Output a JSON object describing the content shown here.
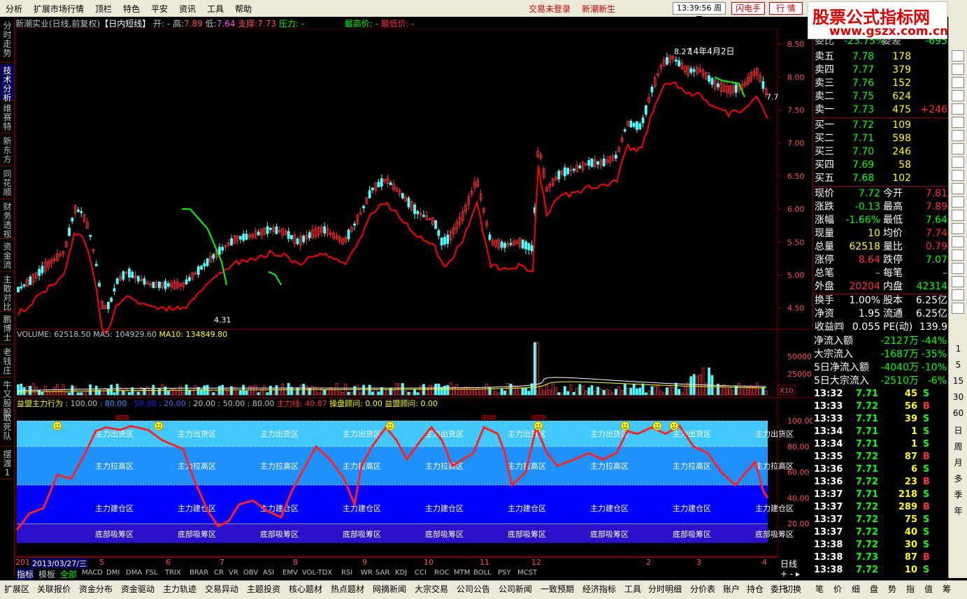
{
  "menu": [
    "分析",
    "扩展市场行情",
    "顶栏",
    "特色",
    "平安",
    "资讯",
    "工具",
    "帮助"
  ],
  "menu_warn": [
    "交易未登录",
    "新潮新生"
  ],
  "clock": "13:39:56 周三",
  "flash": "闪电手",
  "hq": "行 情",
  "brand": {
    "line1": "股票公式指标网",
    "line2": "www.gszx.com.cn"
  },
  "left_tabs": [
    "分时走势",
    "技术分析",
    "维赛特",
    "新东方",
    "同花顺",
    "财务透视",
    "资金流",
    "主散对比",
    "鹏博士",
    "老钱庄",
    "牛又股股",
    "敢死队",
    "摆渡1"
  ],
  "title": {
    "name": "新潮实业(日线,前复权)",
    "formula": "【日内短线】",
    "open": "开: -",
    "high_l": "高:",
    "high_v": "7.89",
    "low_l": "低:",
    "low_v": "7.64",
    "support_l": "支撑:",
    "support_v": "7.73",
    "pressure_l": "压力: -",
    "maxp": "最高价: -",
    "minp": "最低价: -"
  },
  "annot": {
    "hi": "8.27",
    "date": "14年4月2日",
    "lo": "4.31",
    "lastv": "7.7"
  },
  "price_axis": [
    "8.50",
    "8.00",
    "7.50",
    "7.00",
    "6.50",
    "6.00",
    "5.50",
    "5.00",
    "4.50"
  ],
  "volume_label": {
    "vol": "VOLUME: 62518.50",
    "ma5": "MA5: 104929.60",
    "ma10": "MA10: 134849.80"
  },
  "vol_axis": [
    "50000",
    "25000"
  ],
  "vol_unit": "X10",
  "ind_label": {
    "name": "益盟主力行为",
    "p1": ": 100.00",
    "p2": ": 80.00",
    "p3": ": 50.00",
    "p4": ": 20.00",
    "p5": ": 20.00",
    "p6": ": 50.00",
    "p7": ": 80.00",
    "zl": "主力线: 40.87",
    "ph": "操盘顾问: 0.00",
    "ym": "益盟顾问: 0.00"
  },
  "ind_axis": [
    "100.00",
    "80.00",
    "60.00",
    "40.00",
    "20.00"
  ],
  "zones": [
    "主力出货区",
    "主力拉高区",
    "主力建仓区",
    "底部吸筹区"
  ],
  "date": {
    "prefix": "201",
    "cur": "2013/03/27/三",
    "months": [
      "5",
      "6",
      "7",
      "8",
      "9",
      "10",
      "11",
      "12",
      "2",
      "3",
      "4"
    ],
    "period": "日线"
  },
  "ind_tabs": [
    "指标",
    "模板",
    "全部",
    "MACD",
    "DMI",
    "DMA",
    "FSL",
    "TRIX",
    "BRAR",
    "CR",
    "VR",
    "OBV",
    "ASI",
    "EMV",
    "VOL-TDX",
    "RSI",
    "WR",
    "SAR",
    "KDJ",
    "CCI",
    "ROC",
    "MTM",
    "BOLL",
    "PSY",
    "MCST"
  ],
  "quote": {
    "wb": [
      "委比",
      "-23.75%",
      "委差",
      "-695"
    ],
    "sell": [
      [
        "卖五",
        "7.78",
        "178",
        ""
      ],
      [
        "卖四",
        "7.77",
        "379",
        ""
      ],
      [
        "卖三",
        "7.76",
        "152",
        ""
      ],
      [
        "卖二",
        "7.75",
        "624",
        ""
      ],
      [
        "卖一",
        "7.73",
        "475",
        "+246"
      ]
    ],
    "buy": [
      [
        "买一",
        "7.72",
        "109"
      ],
      [
        "买二",
        "7.71",
        "598"
      ],
      [
        "买三",
        "7.70",
        "246"
      ],
      [
        "买四",
        "7.69",
        "58"
      ],
      [
        "买五",
        "7.68",
        "102"
      ]
    ],
    "stats": [
      [
        "现价",
        "7.72",
        "今开",
        "7.81"
      ],
      [
        "涨跌",
        "-0.13",
        "最高",
        "7.89"
      ],
      [
        "涨幅",
        "-1.66%",
        "最低",
        "7.64"
      ],
      [
        "现量",
        "10",
        "均价",
        "7.74"
      ],
      [
        "总量",
        "62518",
        "量比",
        "0.79"
      ],
      [
        "涨停",
        "8.64",
        "跌停",
        "7.07"
      ],
      [
        "总笔",
        "–",
        "每笔",
        "–"
      ],
      [
        "外盘",
        "20204",
        "内盘",
        "42314"
      ]
    ],
    "fund": [
      [
        "换手",
        "1.00%",
        "股本",
        "6.25亿"
      ],
      [
        "净资",
        "1.95",
        "流通",
        "6.25亿"
      ],
      [
        "收益㈣",
        "0.055",
        "PE(动)",
        "139.9"
      ]
    ]
  },
  "flow": [
    [
      "净流入额",
      "-2127万",
      "-44%"
    ],
    [
      "大宗流入",
      "-1687万",
      "-35%"
    ],
    [
      "5日净流入额",
      "-4040万",
      "-10%"
    ],
    [
      "5日大宗流入",
      "-2510万",
      "-6%"
    ]
  ],
  "ticks": [
    [
      "13:32",
      "7.71",
      "45",
      "S"
    ],
    [
      "13:33",
      "7.72",
      "56",
      "B"
    ],
    [
      "13:33",
      "7.71",
      "39",
      "S"
    ],
    [
      "13:34",
      "7.71",
      "1",
      "S"
    ],
    [
      "13:34",
      "7.71",
      "1",
      "S"
    ],
    [
      "13:35",
      "7.72",
      "87",
      "B"
    ],
    [
      "13:36",
      "7.71",
      "6",
      "S"
    ],
    [
      "13:36",
      "7.72",
      "23",
      "B"
    ],
    [
      "13:37",
      "7.71",
      "218",
      "S"
    ],
    [
      "13:37",
      "7.72",
      "289",
      "B"
    ],
    [
      "13:37",
      "7.72",
      "75",
      "S"
    ],
    [
      "13:37",
      "7.72",
      "40",
      "S"
    ],
    [
      "13:38",
      "7.72",
      "30",
      "S"
    ],
    [
      "13:38",
      "7.73",
      "87",
      "B"
    ],
    [
      "13:38",
      "7.72",
      "10",
      "S"
    ]
  ],
  "right_nums": [
    "1",
    "5",
    "15",
    "30",
    "60",
    "日",
    "周",
    "月",
    "多",
    "季",
    "年"
  ],
  "bottom": [
    "扩展区",
    "关联报价",
    "资金分布",
    "资金驱动",
    "主力轨迹",
    "交易异动",
    "主题投资",
    "核心题材",
    "热点题材",
    "网摘新闻",
    "大宗交易",
    "公司公告",
    "公司新闻",
    "一致预期",
    "经济指标",
    "工具",
    "分时明细",
    "分价表",
    "账户",
    "持仓",
    "委托"
  ],
  "bottom_right": [
    "切换",
    "笔",
    "价",
    "细",
    "盘",
    "势",
    "指",
    "值",
    "筹"
  ],
  "colors": {
    "up": "#ff3232",
    "down": "#54fcfc",
    "ma": "#ff0000",
    "green": "#00ff00",
    "yellow": "#ffff00"
  }
}
